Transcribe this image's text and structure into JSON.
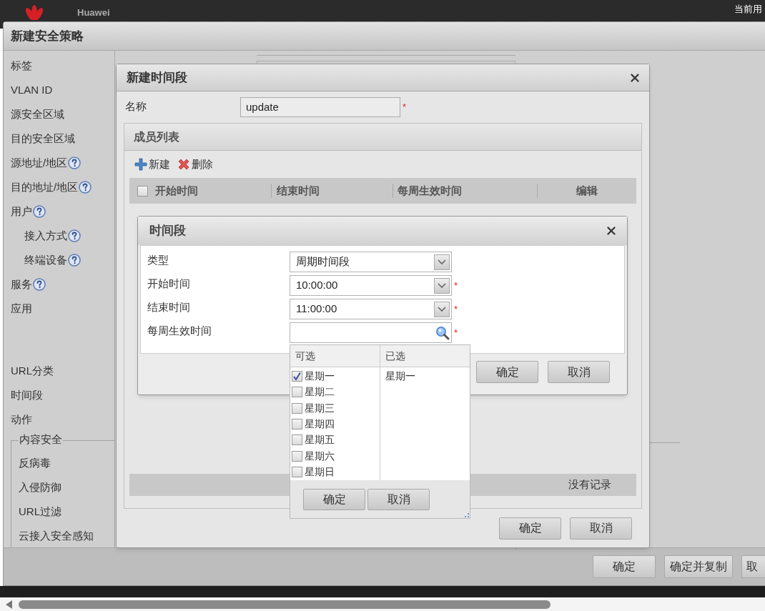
{
  "app_header": {
    "brand": "Huawei",
    "user_label": "当前用"
  },
  "policy_dialog": {
    "title": "新建安全策略",
    "fields": [
      {
        "label": "标签",
        "help": false,
        "indent": false
      },
      {
        "label": "VLAN ID",
        "help": false,
        "indent": false
      },
      {
        "label": "源安全区域",
        "help": false,
        "indent": false
      },
      {
        "label": "目的安全区域",
        "help": false,
        "indent": false
      },
      {
        "label": "源地址/地区",
        "help": true,
        "indent": false
      },
      {
        "label": "目的地址/地区",
        "help": true,
        "indent": false
      },
      {
        "label": "用户",
        "help": true,
        "indent": false
      },
      {
        "label": "接入方式",
        "help": true,
        "indent": true
      },
      {
        "label": "终端设备",
        "help": true,
        "indent": true
      },
      {
        "label": "服务",
        "help": true,
        "indent": false
      },
      {
        "label": "应用",
        "help": false,
        "indent": false
      }
    ],
    "lower_fields": [
      "URL分类",
      "时间段",
      "动作"
    ],
    "content_security": {
      "title": "内容安全",
      "items": [
        "反病毒",
        "入侵防御",
        "URL过滤",
        "云接入安全感知"
      ]
    },
    "buttons": [
      "确定",
      "确定并复制",
      "取"
    ]
  },
  "time_range_dialog": {
    "title": "新建时间段",
    "name_label": "名称",
    "name_value": "update",
    "name_required_mark": "*",
    "members": {
      "title": "成员列表",
      "toolbar": [
        {
          "kind": "add",
          "label": "新建"
        },
        {
          "kind": "delete",
          "label": "删除"
        }
      ],
      "select_all_checked": false,
      "columns": [
        "开始时间",
        "结束时间",
        "每周生效时间",
        "编辑"
      ],
      "empty_text": "没有记录"
    },
    "buttons": [
      "确定",
      "取消"
    ]
  },
  "period_dialog": {
    "title": "时间段",
    "fields": [
      {
        "label": "类型",
        "kind": "select",
        "value": "周期时间段"
      },
      {
        "label": "开始时间",
        "kind": "select",
        "value": "10:00:00",
        "required_mark": "*"
      },
      {
        "label": "结束时间",
        "kind": "select",
        "value": "11:00:00",
        "required_mark": "*"
      },
      {
        "label": "每周生效时间",
        "kind": "search",
        "required_mark": "*"
      }
    ],
    "buttons": [
      "确定",
      "取消"
    ]
  },
  "weekday_picker": {
    "available_header": "可选",
    "selected_header": "已选",
    "days": [
      {
        "label": "星期一",
        "checked": true
      },
      {
        "label": "星期二",
        "checked": false
      },
      {
        "label": "星期三",
        "checked": false
      },
      {
        "label": "星期四",
        "checked": false
      },
      {
        "label": "星期五",
        "checked": false
      },
      {
        "label": "星期六",
        "checked": false
      },
      {
        "label": "星期日",
        "checked": false
      }
    ],
    "chosen": [
      "星期一"
    ],
    "buttons": [
      "确定",
      "取消"
    ]
  }
}
